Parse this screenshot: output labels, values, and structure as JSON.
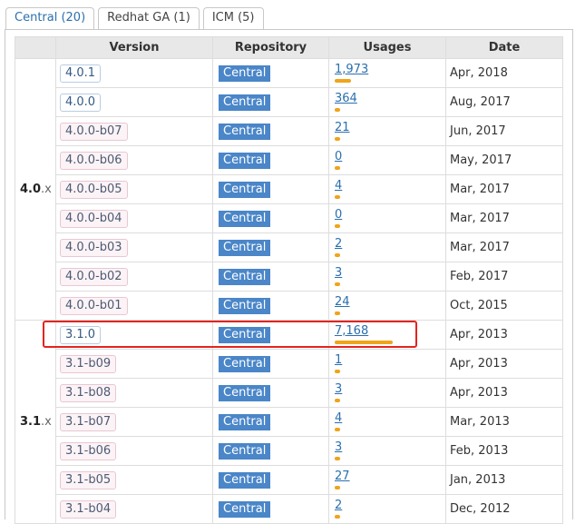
{
  "tabs": [
    {
      "label": "Central (20)",
      "active": true
    },
    {
      "label": "Redhat GA (1)",
      "active": false
    },
    {
      "label": "ICM (5)",
      "active": false
    }
  ],
  "columns": [
    "Version",
    "Repository",
    "Usages",
    "Date"
  ],
  "groups": [
    {
      "major": "4.0",
      "suffix": ".x",
      "rows": [
        {
          "version": "4.0.1",
          "kind": "release",
          "repo": "Central",
          "usages": "1,973",
          "bar": 0.275,
          "date": "Apr, 2018"
        },
        {
          "version": "4.0.0",
          "kind": "release",
          "repo": "Central",
          "usages": "364",
          "bar": 0.05,
          "date": "Aug, 2017"
        },
        {
          "version": "4.0.0-b07",
          "kind": "beta",
          "repo": "Central",
          "usages": "21",
          "bar": 0.01,
          "date": "Jun, 2017"
        },
        {
          "version": "4.0.0-b06",
          "kind": "beta",
          "repo": "Central",
          "usages": "0",
          "bar": 0.01,
          "date": "May, 2017"
        },
        {
          "version": "4.0.0-b05",
          "kind": "beta",
          "repo": "Central",
          "usages": "4",
          "bar": 0.01,
          "date": "Mar, 2017"
        },
        {
          "version": "4.0.0-b04",
          "kind": "beta",
          "repo": "Central",
          "usages": "0",
          "bar": 0.01,
          "date": "Mar, 2017"
        },
        {
          "version": "4.0.0-b03",
          "kind": "beta",
          "repo": "Central",
          "usages": "2",
          "bar": 0.01,
          "date": "Mar, 2017"
        },
        {
          "version": "4.0.0-b02",
          "kind": "beta",
          "repo": "Central",
          "usages": "3",
          "bar": 0.01,
          "date": "Feb, 2017"
        },
        {
          "version": "4.0.0-b01",
          "kind": "beta",
          "repo": "Central",
          "usages": "24",
          "bar": 0.01,
          "date": "Oct, 2015"
        }
      ]
    },
    {
      "major": "3.1",
      "suffix": ".x",
      "rows": [
        {
          "version": "3.1.0",
          "kind": "release",
          "repo": "Central",
          "usages": "7,168",
          "bar": 1.0,
          "date": "Apr, 2013"
        },
        {
          "version": "3.1-b09",
          "kind": "beta",
          "repo": "Central",
          "usages": "1",
          "bar": 0.01,
          "date": "Apr, 2013"
        },
        {
          "version": "3.1-b08",
          "kind": "beta",
          "repo": "Central",
          "usages": "3",
          "bar": 0.01,
          "date": "Apr, 2013"
        },
        {
          "version": "3.1-b07",
          "kind": "beta",
          "repo": "Central",
          "usages": "4",
          "bar": 0.01,
          "date": "Mar, 2013"
        },
        {
          "version": "3.1-b06",
          "kind": "beta",
          "repo": "Central",
          "usages": "3",
          "bar": 0.01,
          "date": "Feb, 2013"
        },
        {
          "version": "3.1-b05",
          "kind": "beta",
          "repo": "Central",
          "usages": "27",
          "bar": 0.01,
          "date": "Jan, 2013"
        },
        {
          "version": "3.1-b04",
          "kind": "beta",
          "repo": "Central",
          "usages": "2",
          "bar": 0.01,
          "date": "Dec, 2012"
        }
      ]
    }
  ],
  "colors": {
    "accent": "#4a86c8",
    "usage_bar": "#f0a419",
    "highlight": "#e5231f"
  }
}
